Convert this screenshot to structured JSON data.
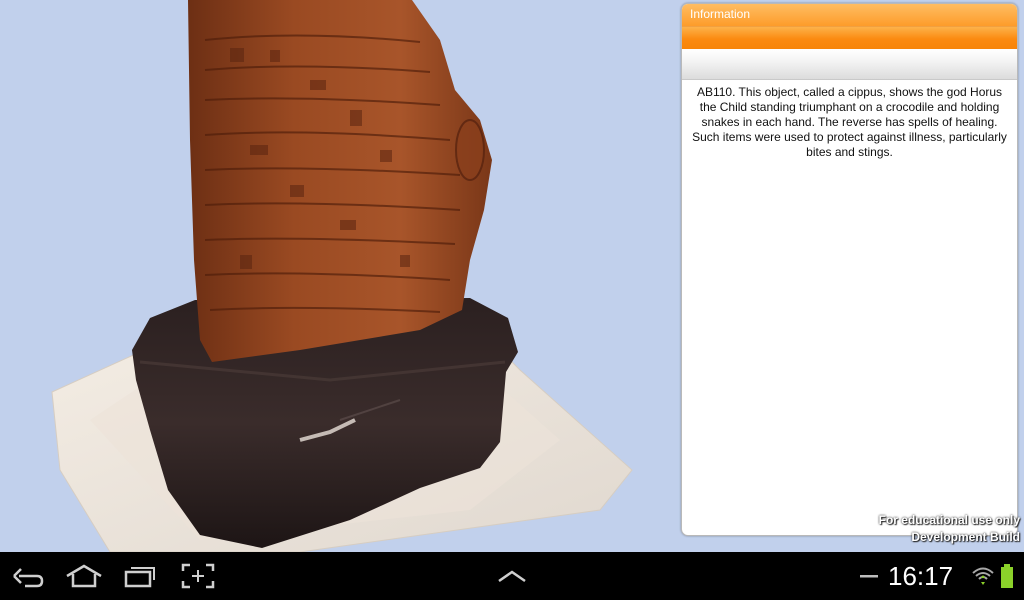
{
  "info_panel": {
    "title": "Information",
    "description": "AB110. This object, called a cippus, shows the god Horus the Child standing triumphant on a crocodile and holding snakes in each hand. The reverse has spells of healing. Such items were used to protect against illness, particularly bites and stings."
  },
  "watermark": {
    "line1": "For educational use only",
    "line2": "Development Build"
  },
  "system_bar": {
    "time": "16:17",
    "buttons": [
      "back-icon",
      "home-icon",
      "recent-apps-icon",
      "screenshot-icon",
      "chevron-up-icon"
    ],
    "status_icons": [
      "minimize-dash-icon",
      "wifi-icon",
      "battery-icon"
    ]
  },
  "colors": {
    "viewport_background": "#c1d0ec",
    "title_bar_orange": "#fd9c2a",
    "battery_green": "#8bd12a",
    "system_bar": "#000000"
  }
}
